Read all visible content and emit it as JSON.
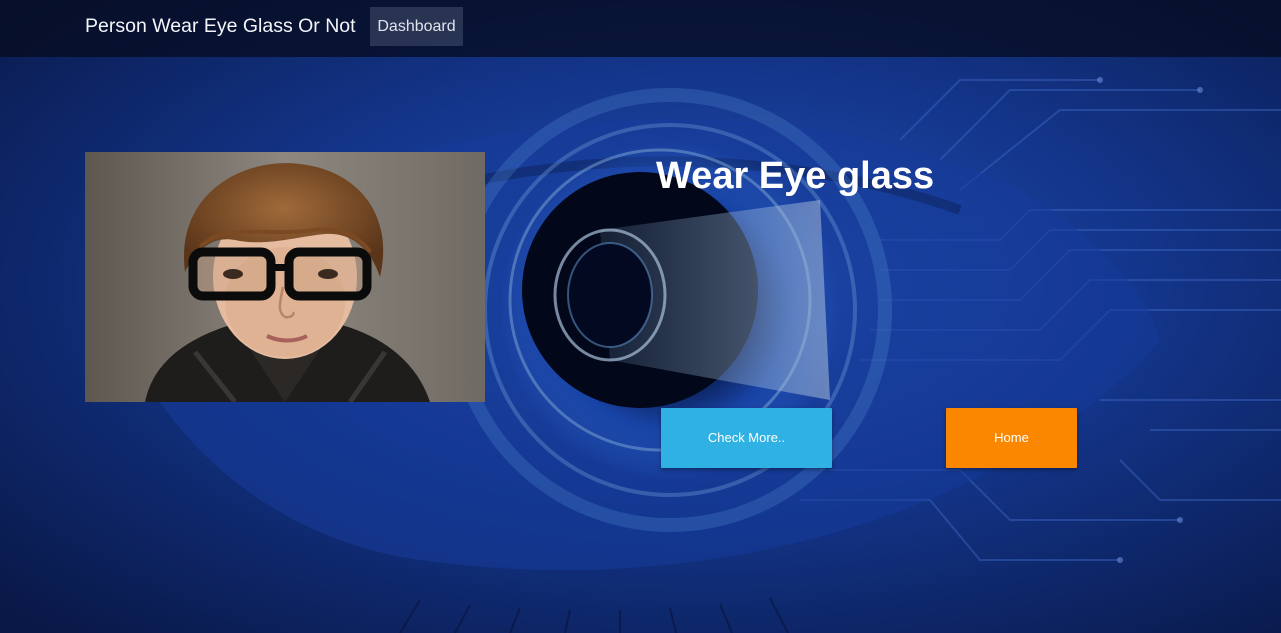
{
  "navbar": {
    "brand": "Person Wear Eye Glass Or Not",
    "links": [
      {
        "label": "Dashboard"
      }
    ]
  },
  "main": {
    "result_title": "Wear Eye glass",
    "buttons": [
      {
        "label": "Check More.."
      },
      {
        "label": "Home"
      }
    ]
  },
  "colors": {
    "navbar_background": "#0a1025",
    "check_more_button": "#2fb1e3",
    "home_button": "#fb8600",
    "title_text": "#ffffff",
    "background_tint": "#123a9a"
  },
  "icons": {
    "background": "eye-circuit-background",
    "photo": "person-with-glasses-photo"
  }
}
